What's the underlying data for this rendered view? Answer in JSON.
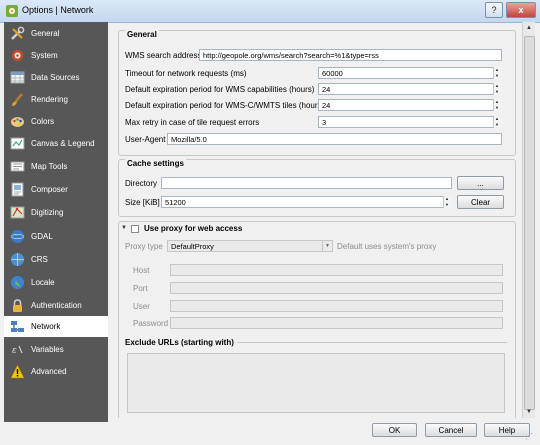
{
  "window": {
    "title": "Options | Network",
    "help": "?",
    "close": "x"
  },
  "sidebar": {
    "items": [
      {
        "label": "General",
        "icon": "wrench-screwdriver-icon"
      },
      {
        "label": "System",
        "icon": "gear-icon"
      },
      {
        "label": "Data Sources",
        "icon": "table-icon"
      },
      {
        "label": "Rendering",
        "icon": "paintbrush-icon"
      },
      {
        "label": "Colors",
        "icon": "paint-palette-icon"
      },
      {
        "label": "Canvas & Legend",
        "icon": "canvas-legend-icon"
      },
      {
        "label": "Map Tools",
        "icon": "map-tools-icon"
      },
      {
        "label": "Composer",
        "icon": "composer-icon"
      },
      {
        "label": "Digitizing",
        "icon": "digitizing-icon"
      },
      {
        "label": "GDAL",
        "icon": "gdal-globe-icon"
      },
      {
        "label": "CRS",
        "icon": "crs-globe-icon"
      },
      {
        "label": "Locale",
        "icon": "locale-globe-icon"
      },
      {
        "label": "Authentication",
        "icon": "padlock-icon"
      },
      {
        "label": "Network",
        "icon": "network-icon"
      },
      {
        "label": "Variables",
        "icon": "variables-icon"
      },
      {
        "label": "Advanced",
        "icon": "warning-triangle-icon"
      }
    ],
    "selected": "Network"
  },
  "general": {
    "title": "General",
    "wms_search_label": "WMS search address",
    "wms_search_value": "http://geopole.org/wms/search?search=%1&type=rss",
    "timeout_label": "Timeout for network requests (ms)",
    "timeout_value": "60000",
    "wms_expiry_label": "Default expiration period for WMS capabilities (hours)",
    "wms_expiry_value": "24",
    "wmts_expiry_label": "Default expiration period for WMS-C/WMTS tiles (hours)",
    "wmts_expiry_value": "24",
    "retry_label": "Max retry in case of tile request errors",
    "retry_value": "3",
    "user_agent_label": "User-Agent",
    "user_agent_value": "Mozilla/5.0"
  },
  "cache": {
    "title": "Cache settings",
    "directory_label": "Directory",
    "directory_value": "",
    "browse_label": "...",
    "size_label": "Size [KiB]",
    "size_value": "51200",
    "clear_label": "Clear"
  },
  "proxy": {
    "title": "Use proxy for web access",
    "enabled": false,
    "type_label": "Proxy type",
    "type_value": "DefaultProxy",
    "type_hint": "Default uses system's proxy",
    "host_label": "Host",
    "port_label": "Port",
    "user_label": "User",
    "password_label": "Password",
    "exclude_title": "Exclude URLs (starting with)"
  },
  "footer": {
    "ok": "OK",
    "cancel": "Cancel",
    "help": "Help"
  },
  "colors": {
    "sidebar_bg": "#575757",
    "titlebar": "#c3d7ef",
    "close": "#c4443a"
  }
}
